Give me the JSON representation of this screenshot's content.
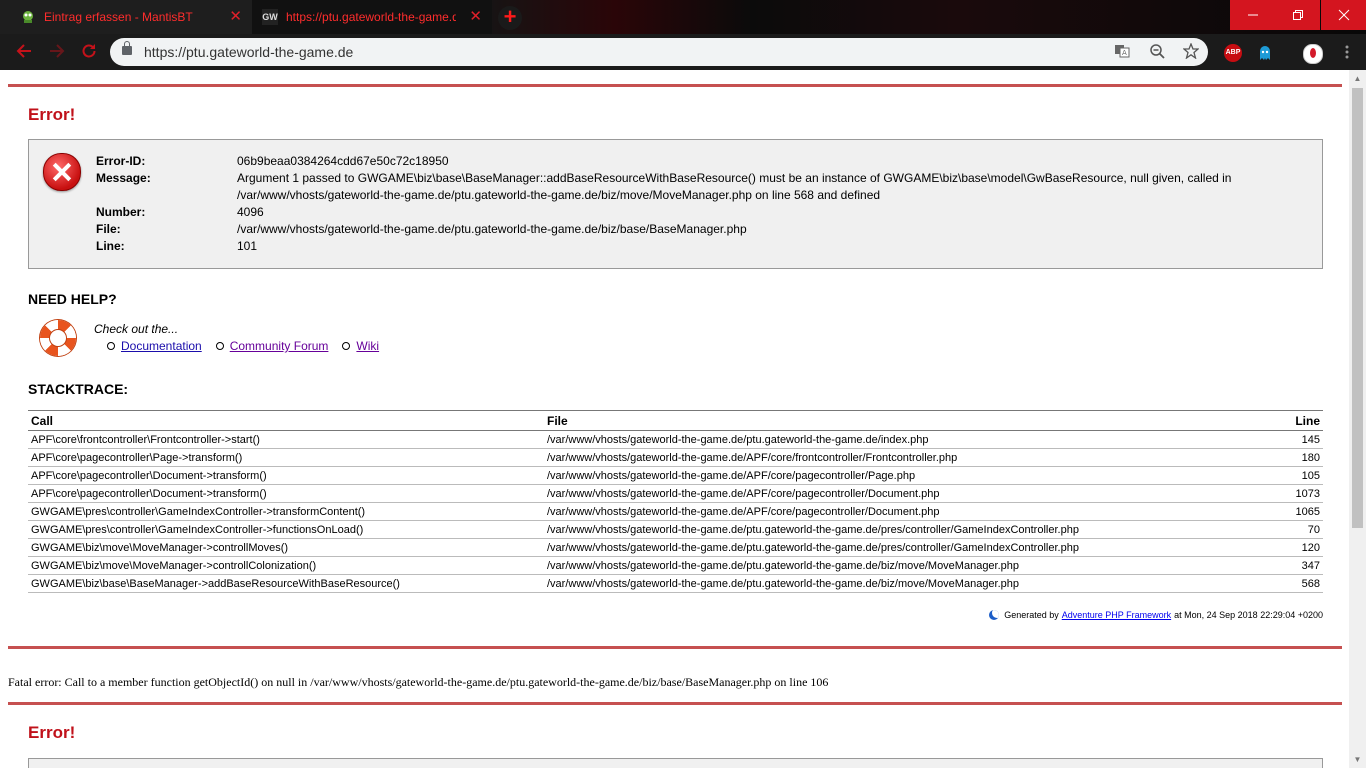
{
  "browser": {
    "tabs": [
      {
        "title": "Eintrag erfassen - MantisBT",
        "close": "✕"
      },
      {
        "title": "https://ptu.gateworld-the-game.de",
        "close": "✕",
        "favicon_text": "GW"
      }
    ],
    "new_tab": "+",
    "url": "https://ptu.gateworld-the-game.de",
    "extensions": {
      "abp": "ABP"
    }
  },
  "error1": {
    "title": "Error!",
    "labels": {
      "id": "Error-ID:",
      "message": "Message:",
      "number": "Number:",
      "file": "File:",
      "line": "Line:"
    },
    "id": "06b9beaa0384264cdd67e50c72c18950",
    "message": "Argument 1 passed to GWGAME\\biz\\base\\BaseManager::addBaseResourceWithBaseResource() must be an instance of GWGAME\\biz\\base\\model\\GwBaseResource, null given, called in /var/www/vhosts/gateworld-the-game.de/ptu.gateworld-the-game.de/biz/move/MoveManager.php on line 568 and defined",
    "number": "4096",
    "file": "/var/www/vhosts/gateworld-the-game.de/ptu.gateworld-the-game.de/biz/base/BaseManager.php",
    "line": "101"
  },
  "help": {
    "heading": "NEED HELP?",
    "intro": "Check out the...",
    "links": [
      "Documentation",
      "Community Forum",
      "Wiki"
    ]
  },
  "stacktrace": {
    "heading": "STACKTRACE:",
    "columns": [
      "Call",
      "File",
      "Line"
    ],
    "rows": [
      {
        "call": "APF\\core\\frontcontroller\\Frontcontroller->start()",
        "file": "/var/www/vhosts/gateworld-the-game.de/ptu.gateworld-the-game.de/index.php",
        "line": "145"
      },
      {
        "call": "APF\\core\\pagecontroller\\Page->transform()",
        "file": "/var/www/vhosts/gateworld-the-game.de/APF/core/frontcontroller/Frontcontroller.php",
        "line": "180"
      },
      {
        "call": "APF\\core\\pagecontroller\\Document->transform()",
        "file": "/var/www/vhosts/gateworld-the-game.de/APF/core/pagecontroller/Page.php",
        "line": "105"
      },
      {
        "call": "APF\\core\\pagecontroller\\Document->transform()",
        "file": "/var/www/vhosts/gateworld-the-game.de/APF/core/pagecontroller/Document.php",
        "line": "1073"
      },
      {
        "call": "GWGAME\\pres\\controller\\GameIndexController->transformContent()",
        "file": "/var/www/vhosts/gateworld-the-game.de/APF/core/pagecontroller/Document.php",
        "line": "1065"
      },
      {
        "call": "GWGAME\\pres\\controller\\GameIndexController->functionsOnLoad()",
        "file": "/var/www/vhosts/gateworld-the-game.de/ptu.gateworld-the-game.de/pres/controller/GameIndexController.php",
        "line": "70"
      },
      {
        "call": "GWGAME\\biz\\move\\MoveManager->controllMoves()",
        "file": "/var/www/vhosts/gateworld-the-game.de/ptu.gateworld-the-game.de/pres/controller/GameIndexController.php",
        "line": "120"
      },
      {
        "call": "GWGAME\\biz\\move\\MoveManager->controllColonization()",
        "file": "/var/www/vhosts/gateworld-the-game.de/ptu.gateworld-the-game.de/biz/move/MoveManager.php",
        "line": "347"
      },
      {
        "call": "GWGAME\\biz\\base\\BaseManager->addBaseResourceWithBaseResource()",
        "file": "/var/www/vhosts/gateworld-the-game.de/ptu.gateworld-the-game.de/biz/move/MoveManager.php",
        "line": "568"
      }
    ]
  },
  "footer": {
    "generated_prefix": "Generated by",
    "framework_link": "Adventure PHP Framework",
    "generated_suffix": "at Mon, 24 Sep 2018 22:29:04 +0200"
  },
  "fatal": "Fatal error: Call to a member function getObjectId() on null in /var/www/vhosts/gateworld-the-game.de/ptu.gateworld-the-game.de/biz/base/BaseManager.php on line 106",
  "error2": {
    "title": "Error!"
  },
  "colors": {
    "accent": "#c0111a",
    "rule": "#c65050",
    "link": "#1a0dab",
    "chrome_red": "#d4151f"
  }
}
